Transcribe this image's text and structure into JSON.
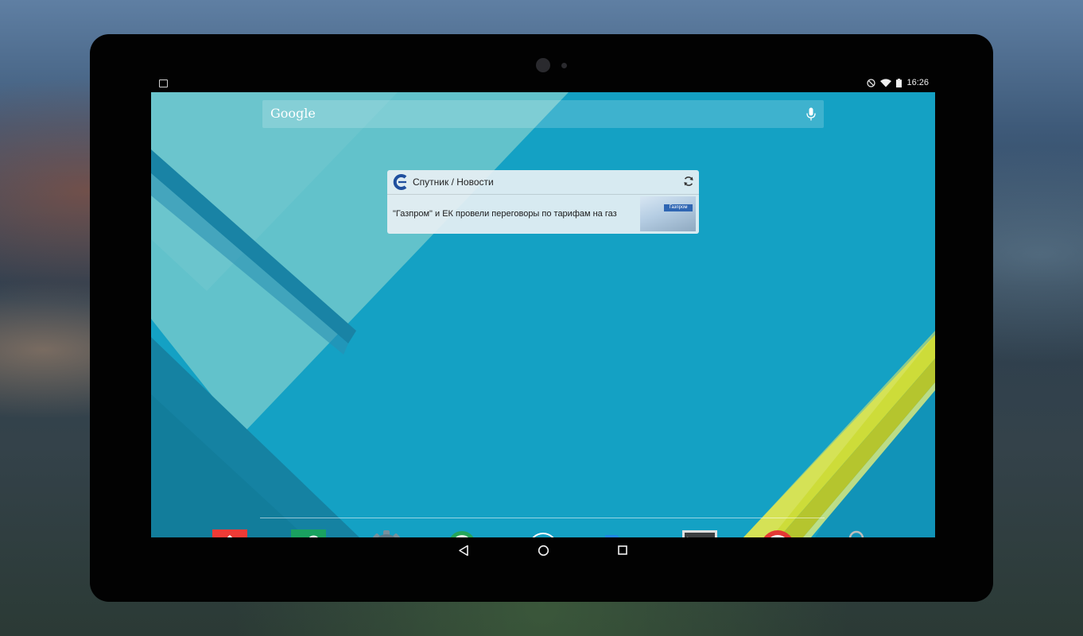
{
  "status_bar": {
    "time": "16:26",
    "icons": [
      "image-notification-icon",
      "do-not-disturb-icon",
      "wifi-icon",
      "battery-icon"
    ]
  },
  "search": {
    "logo_text": "Google"
  },
  "news_widget": {
    "title": "Спутник / Новости",
    "headline": "\"Газпром\" и ЕК провели переговоры по тарифам на газ",
    "thumb_sign_text": "Газпром"
  },
  "dock": {
    "apps": [
      {
        "icon": "home-app-icon",
        "color": "#ef3b36"
      },
      {
        "icon": "link-app-icon",
        "color": "#1aa260"
      },
      {
        "icon": "settings-gear-icon",
        "color": "#607d8b"
      },
      {
        "icon": "eye-search-app-icon",
        "color": "#26a65b"
      },
      {
        "icon": "all-apps-icon",
        "color": "#ffffff"
      },
      {
        "icon": "es-file-explorer-icon",
        "color": "#1e88e5"
      },
      {
        "icon": "android-terminal-icon",
        "color": "#3c3f41"
      },
      {
        "icon": "record-app-icon",
        "color": "#e53935"
      },
      {
        "icon": "play-store-icon",
        "color": "#f1f1f1"
      }
    ]
  },
  "navigation": {
    "buttons": [
      "back-icon",
      "home-icon",
      "recents-icon"
    ]
  },
  "colors": {
    "wallpaper_primary": "#14a1c4",
    "wallpaper_light": "#5ec0c8",
    "wallpaper_stripe": "#1b86a8",
    "wallpaper_yellow": "#cddc39",
    "bezel": "#020202"
  }
}
